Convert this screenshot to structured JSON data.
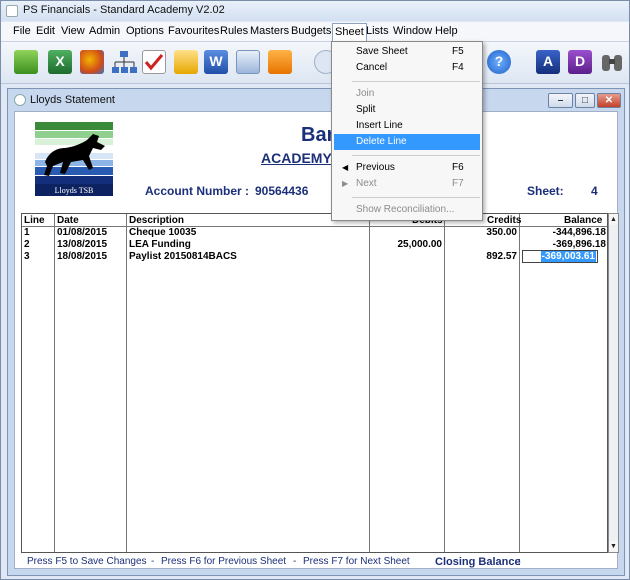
{
  "app": {
    "title": "PS Financials - Standard Academy V2.02"
  },
  "menubar": {
    "items": [
      "File",
      "Edit",
      "View",
      "Admin",
      "Options",
      "Favourites",
      "Rules",
      "Masters",
      "Budgets",
      "Sheet",
      "Lists",
      "Window",
      "Help"
    ]
  },
  "toolbar": {
    "buttons": [
      "basket-icon",
      "excel-icon",
      "chart-icon",
      "org-chart-icon",
      "checklist-icon",
      "mail-icon",
      "word-icon",
      "send-icon",
      "user-icon",
      "help-icon",
      "A",
      "D",
      "binoculars-icon"
    ]
  },
  "document": {
    "title": "Lloyds Statement",
    "logo_text": "Lloyds TSB",
    "heading": "Ban",
    "subheading": "ACADEMY",
    "account_label": "Account Number :",
    "account_number": "90564436",
    "sheet_label": "Sheet:",
    "sheet_number": "4"
  },
  "table": {
    "headers": {
      "line": "Line",
      "date": "Date",
      "description": "Description",
      "debits": "Debits",
      "credits": "Credits",
      "balance": "Balance"
    },
    "rows": [
      {
        "line": "1",
        "date": "01/08/2015",
        "description": "Cheque 10035",
        "debits": "",
        "credits": "350.00",
        "balance": "-344,896.18"
      },
      {
        "line": "2",
        "date": "13/08/2015",
        "description": "LEA Funding",
        "debits": "25,000.00",
        "credits": "",
        "balance": "-369,896.18"
      },
      {
        "line": "3",
        "date": "18/08/2015",
        "description": "Paylist 20150814BACS",
        "debits": "",
        "credits": "892.57",
        "balance": "-369,003.61"
      }
    ]
  },
  "footer": {
    "save": "Press F5 to Save Changes",
    "sep1": "-",
    "prev": "Press F6 for Previous Sheet",
    "sep2": "-",
    "next": "Press F7 for Next Sheet",
    "closing_label": "Closing Balance",
    "closing_colon": ":"
  },
  "sheet_menu": {
    "items": [
      {
        "label": "Save Sheet",
        "key": "F5"
      },
      {
        "label": "Cancel",
        "key": "F4"
      },
      {
        "label": "Join",
        "key": ""
      },
      {
        "label": "Split",
        "key": ""
      },
      {
        "label": "Insert Line",
        "key": ""
      },
      {
        "label": "Delete Line",
        "key": ""
      },
      {
        "label": "Previous",
        "key": "F6"
      },
      {
        "label": "Next",
        "key": "F7"
      },
      {
        "label": "Show Reconciliation...",
        "key": ""
      }
    ]
  },
  "colors": {
    "accent": "#1c2f7a",
    "selection": "#3399ff",
    "logo_green": "#3a8a3a"
  }
}
